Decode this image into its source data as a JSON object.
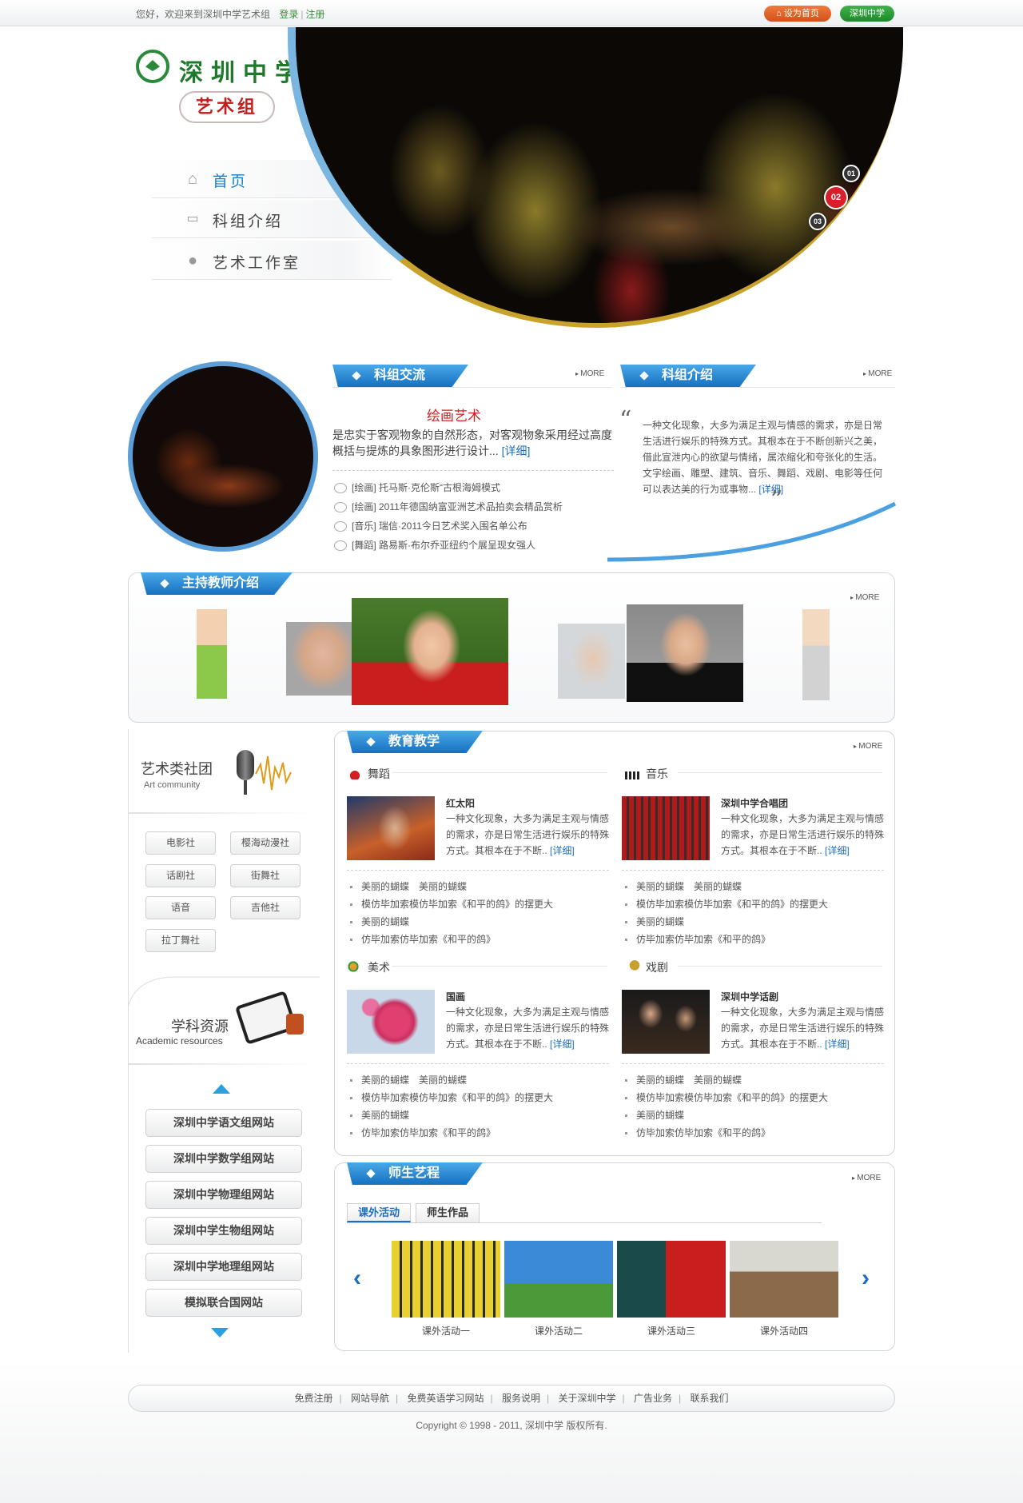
{
  "topbar": {
    "welcome": "您好，欢迎来到深圳中学艺术组",
    "login": "登录",
    "register": "注册",
    "set_home": "设为首页",
    "school": "深圳中学"
  },
  "logo": {
    "title": "深圳中学",
    "subtitle": "艺术组"
  },
  "nav": [
    {
      "label": "首页"
    },
    {
      "label": "科组介绍"
    },
    {
      "label": "艺术工作室"
    }
  ],
  "hero": {
    "dots": [
      "01",
      "02",
      "03"
    ],
    "active_dot": "02"
  },
  "exchange": {
    "title": "科组交流",
    "more": "MORE",
    "headline": "绘画艺术",
    "summary": "是忠实于客观物象的自然形态，对客观物象采用经过高度概括与提炼的具象图形进行设计...",
    "detail": "[详细]",
    "list": [
      "[绘画] 托马斯·克伦斯“古根海姆模式",
      "[绘画] 2011年德国纳富亚洲艺术品拍卖会精品赏析",
      "[音乐] 瑞信·2011今日艺术奖入围名单公布",
      "[舞蹈] 路易斯·布尔乔亚纽约个展呈现女强人"
    ]
  },
  "intro": {
    "title": "科组介绍",
    "more": "MORE",
    "text": "一种文化现象，大多为满足主观与情感的需求，亦是日常生活进行娱乐的特殊方式。其根本在于不断创新兴之美，借此宣泄内心的欲望与情绪，属浓缩化和夸张化的生活。文字绘画、雕塑、建筑、音乐、舞蹈、戏剧、电影等任何可以表达美的行为或事物...",
    "detail": "[详细]"
  },
  "teachers": {
    "title": "主持教师介绍",
    "more": "MORE"
  },
  "clubs": {
    "title": "艺术类社团",
    "subtitle": "Art community",
    "items": [
      "电影社",
      "樱海动漫社",
      "话剧社",
      "街舞社",
      "语音",
      "吉他社",
      "拉丁舞社"
    ]
  },
  "resources": {
    "title": "学科资源",
    "subtitle": "Academic resources",
    "links": [
      "深圳中学语文组网站",
      "深圳中学数学组网站",
      "深圳中学物理组网站",
      "深圳中学生物组网站",
      "深圳中学地理组网站",
      "模拟联合国网站"
    ]
  },
  "education": {
    "title": "教育教学",
    "more": "MORE",
    "subjects": [
      {
        "name": "舞蹈",
        "item_title": "红太阳",
        "item_desc": "一种文化现象，大多为满足主观与情感的需求，亦是日常生活进行娱乐的特殊方式。其根本在于不断..",
        "detail": "[详细]",
        "bullets": [
          "美丽的蝴蝶　美丽的蝴蝶",
          "模仿毕加索模仿毕加索《和平的鸽》的摆更大",
          "美丽的蝴蝶",
          "仿毕加索仿毕加索《和平的鸽》"
        ]
      },
      {
        "name": "音乐",
        "item_title": "深圳中学合唱团",
        "item_desc": "一种文化现象，大多为满足主观与情感的需求，亦是日常生活进行娱乐的特殊方式。其根本在于不断..",
        "detail": "[详细]",
        "bullets": [
          "美丽的蝴蝶　美丽的蝴蝶",
          "模仿毕加索模仿毕加索《和平的鸽》的摆更大",
          "美丽的蝴蝶",
          "仿毕加索仿毕加索《和平的鸽》"
        ]
      },
      {
        "name": "美术",
        "item_title": "国画",
        "item_desc": "一种文化现象，大多为满足主观与情感的需求，亦是日常生活进行娱乐的特殊方式。其根本在于不断..",
        "detail": "[详细]",
        "bullets": [
          "美丽的蝴蝶　美丽的蝴蝶",
          "模仿毕加索模仿毕加索《和平的鸽》的摆更大",
          "美丽的蝴蝶",
          "仿毕加索仿毕加索《和平的鸽》"
        ]
      },
      {
        "name": "戏剧",
        "item_title": "深圳中学话剧",
        "item_desc": "一种文化现象，大多为满足主观与情感的需求，亦是日常生活进行娱乐的特殊方式。其根本在于不断..",
        "detail": "[详细]",
        "bullets": [
          "美丽的蝴蝶　美丽的蝴蝶",
          "模仿毕加索模仿毕加索《和平的鸽》的摆更大",
          "美丽的蝴蝶",
          "仿毕加索仿毕加索《和平的鸽》"
        ]
      }
    ]
  },
  "activities": {
    "title": "师生艺程",
    "more": "MORE",
    "tabs": [
      "课外活动",
      "师生作品"
    ],
    "items": [
      "课外活动一",
      "课外活动二",
      "课外活动三",
      "课外活动四"
    ]
  },
  "footer": {
    "links": [
      "免费注册",
      "网站导航",
      "免费英语学习网站",
      "服务说明",
      "关于深圳中学",
      "广告业务",
      "联系我们"
    ],
    "copyright": "Copyright © 1998 - 2011, 深圳中学 版权所有."
  },
  "colors": {
    "brand_green": "#1e7a2a",
    "accent_blue": "#1a6ec0",
    "accent_red": "#d02020"
  }
}
